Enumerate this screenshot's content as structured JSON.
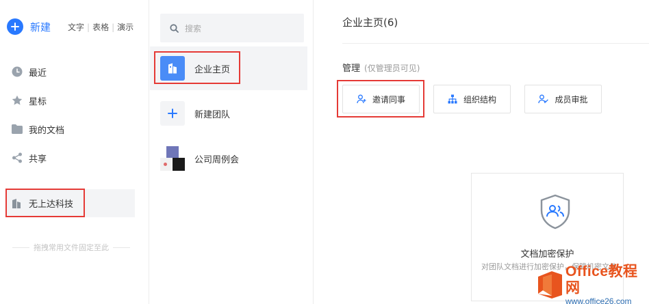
{
  "sidebar": {
    "new_label": "新建",
    "new_types": [
      "文字",
      "表格",
      "演示"
    ],
    "nav": [
      {
        "label": "最近",
        "icon": "clock-icon"
      },
      {
        "label": "星标",
        "icon": "star-icon"
      },
      {
        "label": "我的文档",
        "icon": "folder-icon"
      },
      {
        "label": "共享",
        "icon": "share-icon"
      }
    ],
    "team": {
      "label": "无上达科技",
      "icon": "building-icon"
    },
    "hint": "拖拽常用文件固定至此"
  },
  "middle": {
    "search_placeholder": "搜索",
    "items": [
      {
        "label": "企业主页",
        "icon": "building-icon"
      },
      {
        "label": "新建团队",
        "icon": "plus-icon"
      },
      {
        "label": "公司周例会",
        "icon": "group-avatar-icon"
      }
    ]
  },
  "main": {
    "title": "企业主页(6)",
    "manage_label": "管理",
    "manage_note": "(仅管理员可见)",
    "actions": [
      {
        "label": "邀请同事",
        "icon": "invite-user-icon"
      },
      {
        "label": "组织结构",
        "icon": "org-chart-icon"
      },
      {
        "label": "成员审批",
        "icon": "approve-user-icon"
      }
    ],
    "card": {
      "title": "文档加密保护",
      "desc": "对团队文档进行加密保护，保障机密文件不外泄"
    }
  },
  "watermark": {
    "brand": "Office教程网",
    "url": "www.office26.com"
  },
  "colors": {
    "accent": "#2979ff",
    "highlight": "#e53935",
    "watermark_orange": "#e8541e"
  }
}
